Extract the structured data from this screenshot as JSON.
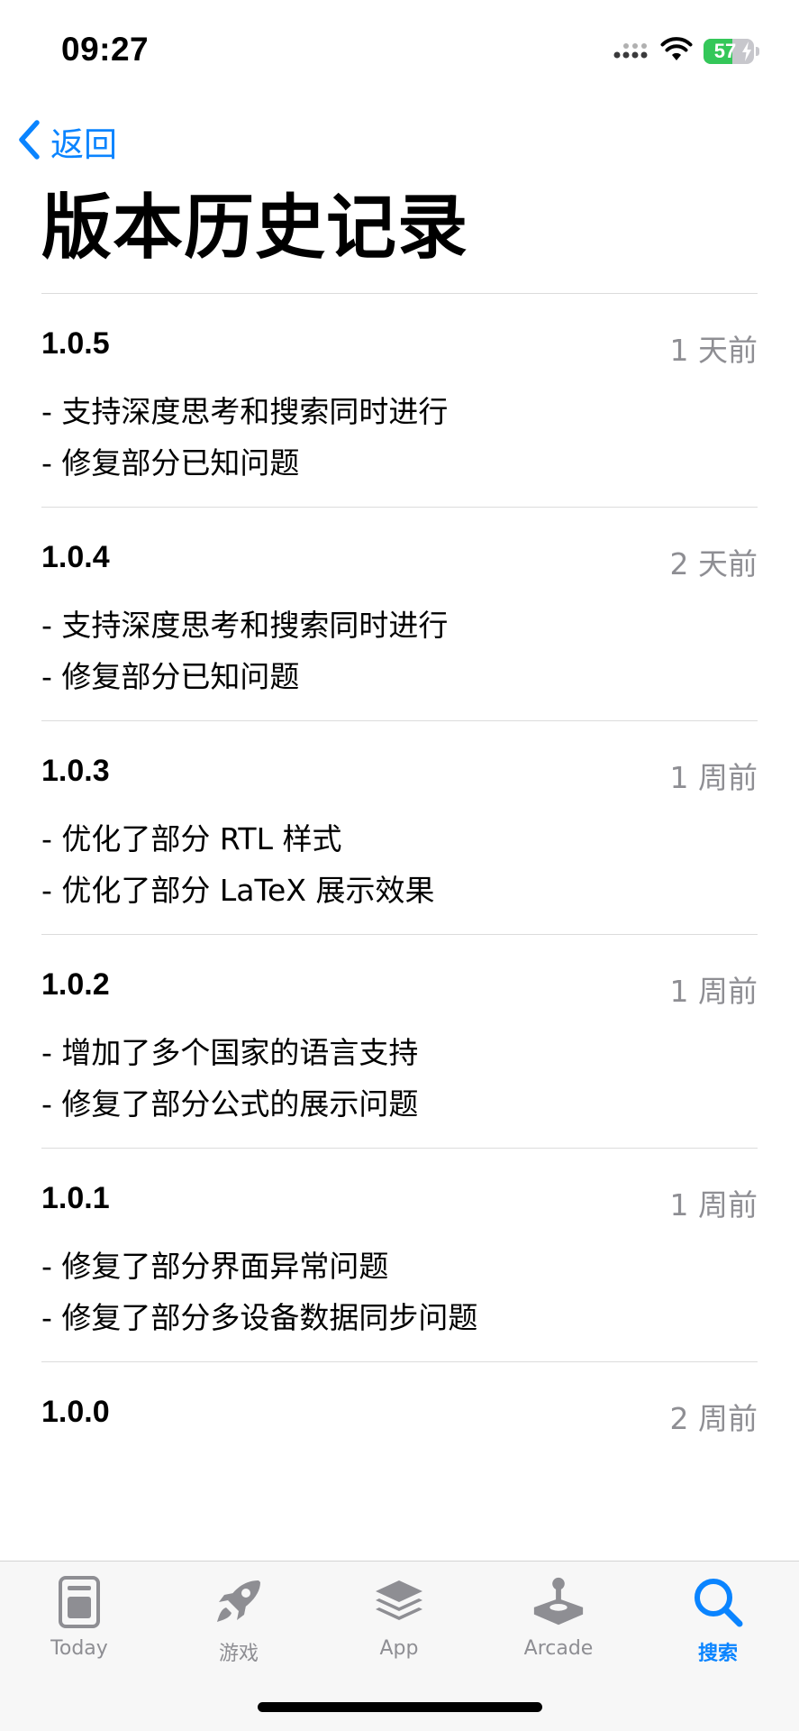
{
  "status_bar": {
    "time": "09:27",
    "battery_percent": "57",
    "battery_level": 0.57,
    "battery_color": "#34c759"
  },
  "nav": {
    "back_label": "返回",
    "back_icon": "chevron-left-icon",
    "accent_color": "#0a84ff"
  },
  "page": {
    "title": "版本历史记录"
  },
  "versions": [
    {
      "number": "1.0.5",
      "date": "1 天前",
      "notes": [
        "- 支持深度思考和搜索同时进行",
        "- 修复部分已知问题"
      ]
    },
    {
      "number": "1.0.4",
      "date": "2 天前",
      "notes": [
        "- 支持深度思考和搜索同时进行",
        "- 修复部分已知问题"
      ]
    },
    {
      "number": "1.0.3",
      "date": "1 周前",
      "notes": [
        "- 优化了部分 RTL 样式",
        "- 优化了部分 LaTeX 展示效果"
      ]
    },
    {
      "number": "1.0.2",
      "date": "1 周前",
      "notes": [
        "- 增加了多个国家的语言支持",
        "- 修复了部分公式的展示问题"
      ]
    },
    {
      "number": "1.0.1",
      "date": "1 周前",
      "notes": [
        "- 修复了部分界面异常问题",
        "- 修复了部分多设备数据同步问题"
      ]
    },
    {
      "number": "1.0.0",
      "date": "2 周前",
      "notes": []
    }
  ],
  "tab_bar": {
    "tabs": [
      {
        "label": "Today",
        "icon": "today-icon",
        "active": false
      },
      {
        "label": "游戏",
        "icon": "rocket-icon",
        "active": false
      },
      {
        "label": "App",
        "icon": "app-stack-icon",
        "active": false
      },
      {
        "label": "Arcade",
        "icon": "joystick-icon",
        "active": false
      },
      {
        "label": "搜索",
        "icon": "search-icon",
        "active": true
      }
    ]
  }
}
